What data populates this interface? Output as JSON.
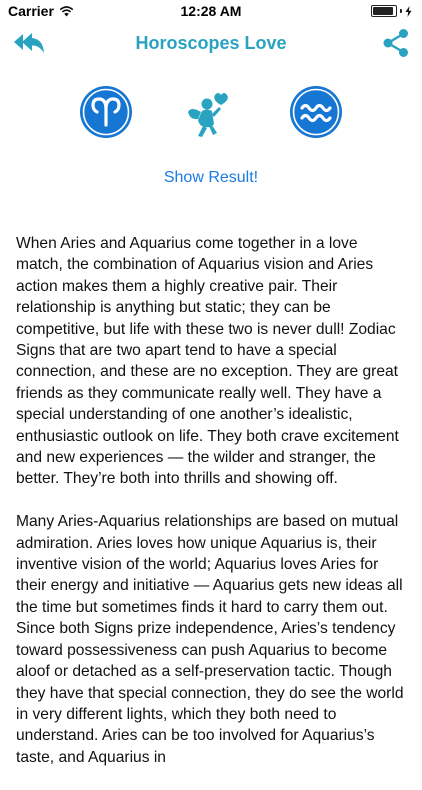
{
  "status_bar": {
    "carrier": "Carrier",
    "time": "12:28 AM",
    "battery_level": 0.9
  },
  "nav": {
    "title": "Horoscopes Love",
    "back_icon": "double-reply-arrow-icon",
    "share_icon": "share-icon"
  },
  "signs": {
    "left": "aries",
    "right": "aquarius",
    "middle_icon": "cupid-icon"
  },
  "show_result_label": "Show Result!",
  "colors": {
    "accent": "#2aa3c1",
    "sign_circle": "#1676d4",
    "cupid": "#2aa3c1",
    "link": "#1a7be0"
  },
  "paragraphs": [
    "When Aries and Aquarius come together in a love match, the combination of Aquarius vision and Aries action makes them a highly creative pair. Their relationship is anything but static; they can be competitive, but life with these two is never dull! Zodiac Signs that are two apart tend to have a special connection, and these are no exception. They are great friends as they communicate really well. They have a special understanding of one another’s idealistic, enthusiastic outlook on life. They both crave excitement and new experiences — the wilder and stranger, the better. They’re both into thrills and showing off.",
    "Many Aries-Aquarius relationships are based on mutual admiration. Aries loves how unique Aquarius is, their inventive vision of the world; Aquarius loves Aries for their energy and initiative — Aquarius gets new ideas all the time but sometimes finds it hard to carry them out. Since both Signs prize independence, Aries’s tendency toward possessiveness can push Aquarius to become aloof or detached as a self-preservation tactic. Though they have that special connection, they do see the world in very different lights, which they both need to understand. Aries can be too involved for Aquarius’s taste, and Aquarius in"
  ]
}
